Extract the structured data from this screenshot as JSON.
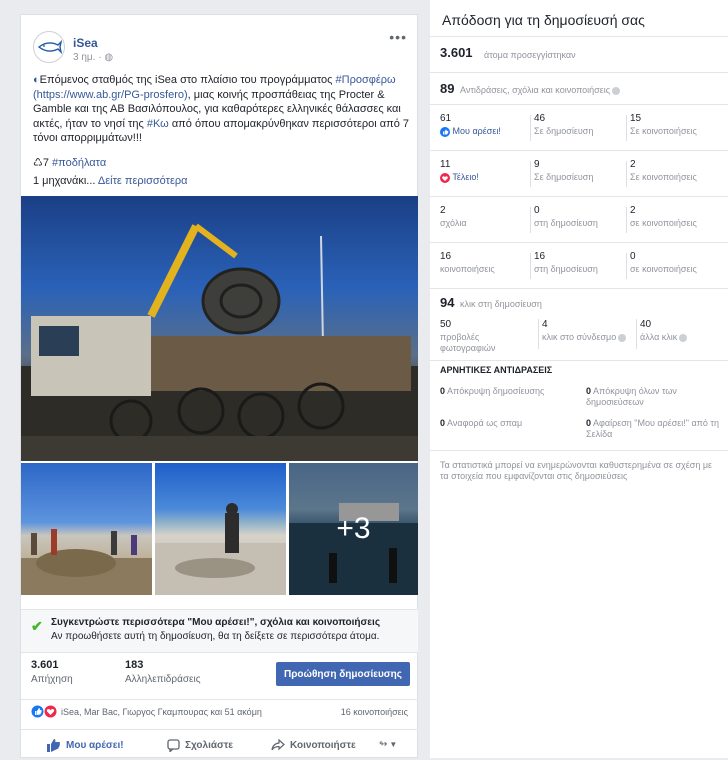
{
  "post": {
    "page_name": "iSea",
    "time": "3 ημ. ·",
    "menu_dots": "•••",
    "text_lead": "Επόμενος σταθμός της iSea στο πλαίσιο του προγράμματος ",
    "hashtag1": "#Προσφέρω",
    "url": " (https://www.ab.gr/PG-prosfero)",
    "text_mid": ", μιας κοινής προσπάθειας της Procter & Gamble και της ΑΒ Βασιλόπουλος, για καθαρότερες ελληνικές θάλασσες και ακτές, ήταν το νησί της ",
    "hashtag2": "#Κω",
    "text_end": " από όπου απομακρύνθηκαν περισσότεροι από 7 τόνοι απορριμμάτων!!!",
    "line2_prefix": "♺7 ",
    "hashtag3": "#ποδήλατα",
    "line3_text": "1 μηχανάκι... ",
    "see_more": "Δείτε περισσότερα",
    "more_photos": "+3"
  },
  "boost": {
    "title": "Συγκεντρώστε περισσότερα \"Μου αρέσει!\", σχόλια και κοινοποιήσεις",
    "subtitle": "Αν προωθήσετε αυτή τη δημοσίευση, θα τη δείξετε σε περισσότερα άτομα.",
    "reach_value": "3.601",
    "reach_label": "Απήχηση",
    "engagement_value": "183",
    "engagement_label": "Αλληλεπιδράσεις",
    "promote_button": "Προώθηση δημοσίευσης"
  },
  "reactions": {
    "names": "iSea, Mar Bac, Γιωργος Γκαμπουρας και 51 ακόμη",
    "shares": "16 κοινοποιήσεις"
  },
  "actions": {
    "like": "Μου αρέσει!",
    "comment": "Σχολιάστε",
    "share": "Κοινοποιήστε"
  },
  "insights": {
    "title": "Απόδοση για τη δημοσίευσή σας",
    "reached_value": "3.601",
    "reached_label": "άτομα προσεγγίστηκαν",
    "reactions_value": "89",
    "reactions_label": "Αντιδράσεις, σχόλια και κοινοποιήσεις",
    "rows": [
      {
        "value": "61",
        "label": "Μου αρέσει!",
        "post_value": "46",
        "post_label": "Σε δημοσίευση",
        "shares_value": "15",
        "shares_label": "Σε κοινοποιήσεις"
      },
      {
        "value": "11",
        "label": "Τέλειο!",
        "post_value": "9",
        "post_label": "Σε δημοσίευση",
        "shares_value": "2",
        "shares_label": "Σε κοινοποιήσεις"
      },
      {
        "value": "2",
        "label": "σχόλια",
        "post_value": "0",
        "post_label": "στη δημοσίευση",
        "shares_value": "2",
        "shares_label": "σε κοινοποιήσεις"
      },
      {
        "value": "16",
        "label": "κοινοποιήσεις",
        "post_value": "16",
        "post_label": "στη δημοσίευση",
        "shares_value": "0",
        "shares_label": "σε κοινοποιήσεις"
      }
    ],
    "clicks_value": "94",
    "clicks_label": "κλικ στη δημοσίευση",
    "click_cols": [
      {
        "value": "50",
        "label": "προβολές φωτογραφιών"
      },
      {
        "value": "4",
        "label": "κλικ στο σύνδεσμο"
      },
      {
        "value": "40",
        "label": "άλλα κλικ"
      }
    ],
    "negative_title": "ΑΡΝΗΤΙΚΕΣ ΑΝΤΙΔΡΑΣΕΙΣ",
    "negative": [
      {
        "value": "0",
        "label": "Απόκρυψη δημοσίευσης"
      },
      {
        "value": "0",
        "label": "Απόκρυψη όλων των δημοσιεύσεων"
      },
      {
        "value": "0",
        "label": "Αναφορά ως σπαμ"
      },
      {
        "value": "0",
        "label": "Αφαίρεση \"Μου αρέσει!\" από τη Σελίδα"
      }
    ],
    "note_line1": "Τα στατιστικά μπορεί να ενημερώνονται καθυστερημένα σε σχέση με",
    "note_line2": "τα στοιχεία που εμφανίζονται στις δημοσιεύσεις"
  },
  "colors": {
    "fb_blue": "#4267b2",
    "link_blue": "#365899",
    "like_blue": "#1877f2",
    "love_red": "#f0284a",
    "check_green": "#42b72a"
  }
}
